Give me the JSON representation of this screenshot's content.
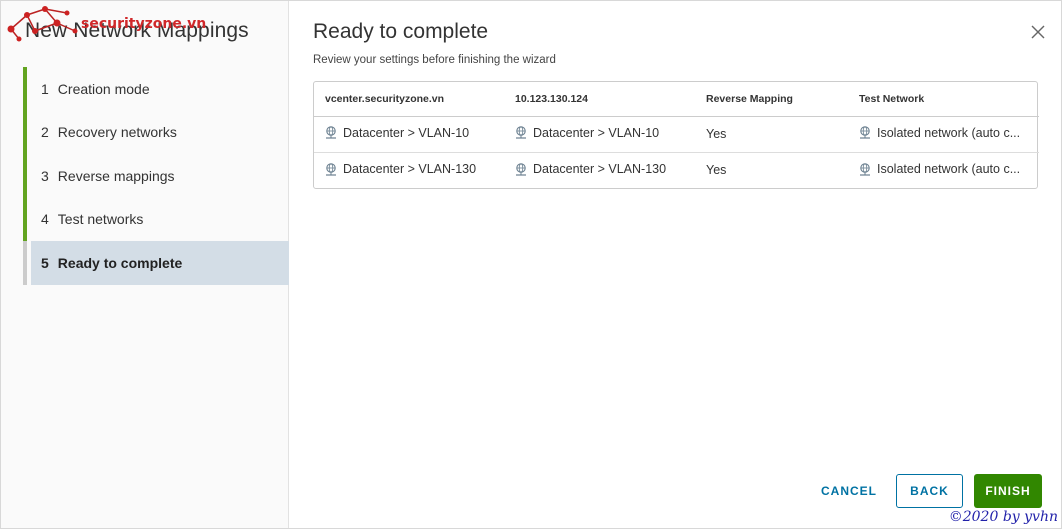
{
  "wizard": {
    "title": "New Network Mappings",
    "logo_text": "securityzone.vn",
    "steps": [
      {
        "num": "1",
        "label": "Creation mode"
      },
      {
        "num": "2",
        "label": "Recovery networks"
      },
      {
        "num": "3",
        "label": "Reverse mappings"
      },
      {
        "num": "4",
        "label": "Test networks"
      },
      {
        "num": "5",
        "label": "Ready to complete"
      }
    ],
    "current_step": 5
  },
  "main": {
    "title": "Ready to complete",
    "subtitle": "Review your settings before finishing the wizard",
    "close_icon": "close-icon"
  },
  "table": {
    "headers": [
      "vcenter.securityzone.vn",
      "10.123.130.124",
      "Reverse Mapping",
      "Test Network"
    ],
    "rows": [
      {
        "source": "Datacenter > VLAN-10",
        "target": "Datacenter > VLAN-10",
        "reverse": "Yes",
        "test": "Isolated network (auto c..."
      },
      {
        "source": "Datacenter > VLAN-130",
        "target": "Datacenter > VLAN-130",
        "reverse": "Yes",
        "test": "Isolated network (auto c..."
      }
    ],
    "row_icon": "network-icon"
  },
  "buttons": {
    "cancel": "CANCEL",
    "back": "BACK",
    "finish": "FINISH"
  },
  "colors": {
    "accent_green": "#62a420",
    "finish_green": "#318700",
    "link_blue": "#0072a3",
    "current_step_bg": "#d3dde6",
    "logo_red": "#d0282a"
  },
  "watermark": "©2020 by yvhn"
}
